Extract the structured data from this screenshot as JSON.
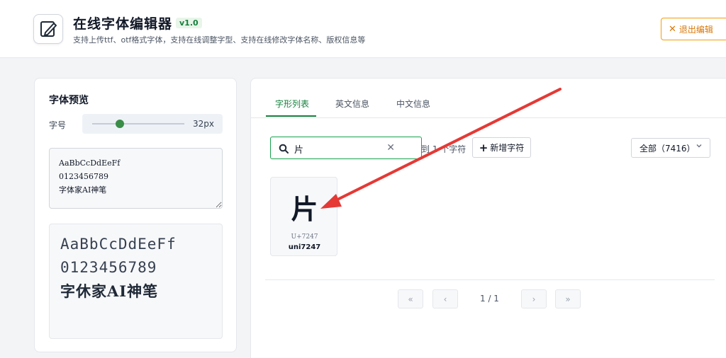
{
  "header": {
    "title": "在线字体编辑器",
    "version": "v1.0",
    "subtitle": "支持上传ttf、otf格式字体，支持在线调整字型、支持在线修改字体名称、版权信息等",
    "exit_label": "退出编辑"
  },
  "preview": {
    "title": "字体预览",
    "size_label": "字号",
    "size_value": "32px",
    "size_fraction": 0.3,
    "sample_text": "AaBbCcDdEeFf\n0123456789\n字体家AI神笔",
    "render_line1": "AaBbCcDdEeFf",
    "render_line2": "0123456789",
    "render_line3": "字休家AI神笔"
  },
  "tabs": [
    {
      "label": "字形列表",
      "active": true
    },
    {
      "label": "英文信息",
      "active": false
    },
    {
      "label": "中文信息",
      "active": false
    }
  ],
  "search": {
    "value": "片",
    "found_text": "到 1 个字符"
  },
  "toolbar": {
    "add_label": "新增字符",
    "filter_label": "全部（7416）"
  },
  "glyphs": [
    {
      "char": "片",
      "code": "U+7247",
      "name": "uni7247"
    }
  ],
  "pagination": {
    "first": "«",
    "prev": "‹",
    "indicator": "1 / 1",
    "next": "›",
    "last": "»"
  },
  "colors": {
    "accent": "#15803d",
    "warning": "#f59e0b",
    "annotation_arrow": "#e53935"
  },
  "icons": {
    "logo": "pen-edit-icon",
    "search": "search-icon",
    "clear": "close-icon",
    "add": "plus-icon",
    "exit": "close-icon",
    "dropdown": "chevron-down-icon"
  }
}
